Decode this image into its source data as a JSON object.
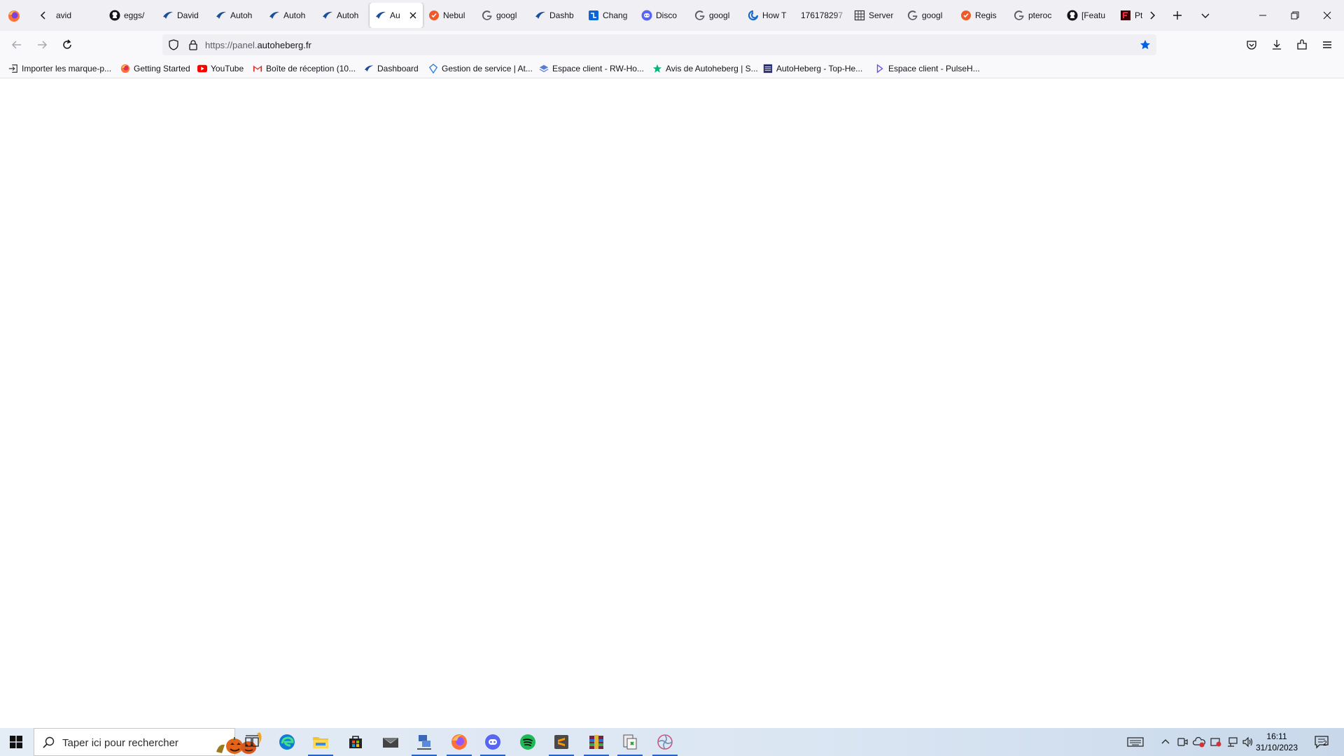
{
  "browser": {
    "tabs": [
      {
        "title": "avid",
        "icon": "partial-icon"
      },
      {
        "title": "eggs/",
        "icon": "github-icon"
      },
      {
        "title": "David",
        "icon": "autoheberg-icon"
      },
      {
        "title": "Autoh",
        "icon": "autoheberg-icon"
      },
      {
        "title": "Autoh",
        "icon": "autoheberg-icon"
      },
      {
        "title": "Autoh",
        "icon": "autoheberg-icon"
      },
      {
        "title": "Au",
        "icon": "autoheberg-icon",
        "active": true
      },
      {
        "title": "Nebul",
        "icon": "orange-check-icon"
      },
      {
        "title": "googl",
        "icon": "google-icon"
      },
      {
        "title": "Dashb",
        "icon": "autoheberg-icon"
      },
      {
        "title": "Chang",
        "icon": "blue-square-icon"
      },
      {
        "title": "Disco",
        "icon": "discord-icon"
      },
      {
        "title": "googl",
        "icon": "google-icon"
      },
      {
        "title": "How T",
        "icon": "blue-swirl-icon"
      },
      {
        "title": "176178297",
        "icon": "none"
      },
      {
        "title": "Server",
        "icon": "grid-icon"
      },
      {
        "title": "googl",
        "icon": "google-icon"
      },
      {
        "title": "Regis",
        "icon": "orange-check-icon"
      },
      {
        "title": "pteroc",
        "icon": "google-icon"
      },
      {
        "title": "[Featu",
        "icon": "github-icon"
      },
      {
        "title": "Pteroc",
        "icon": "pterodactyl-icon"
      }
    ],
    "url": {
      "prefix": "https://panel.",
      "domain": "autoheberg.fr"
    },
    "bookmarks": [
      {
        "label": "Importer les marque-p...",
        "icon": "import-icon"
      },
      {
        "label": "Getting Started",
        "icon": "firefox-icon"
      },
      {
        "label": "YouTube",
        "icon": "youtube-icon"
      },
      {
        "label": "Boîte de réception (10...",
        "icon": "gmail-icon"
      },
      {
        "label": "Dashboard",
        "icon": "autoheberg-icon"
      },
      {
        "label": "Gestion de service | At...",
        "icon": "diamond-icon"
      },
      {
        "label": "Espace client - RW-Ho...",
        "icon": "layers-icon"
      },
      {
        "label": "Avis de Autoheberg | S...",
        "icon": "star-icon"
      },
      {
        "label": "AutoHeberg - Top-He...",
        "icon": "server-icon"
      },
      {
        "label": "Espace client - PulseH...",
        "icon": "pulse-icon"
      }
    ]
  },
  "taskbar": {
    "search_placeholder": "Taper ici pour rechercher",
    "apps": [
      {
        "name": "task-view",
        "running": false
      },
      {
        "name": "edge",
        "running": false
      },
      {
        "name": "file-explorer",
        "running": true
      },
      {
        "name": "store",
        "running": false
      },
      {
        "name": "mail",
        "running": false
      },
      {
        "name": "network-app",
        "running": true
      },
      {
        "name": "firefox",
        "running": true
      },
      {
        "name": "discord",
        "running": true
      },
      {
        "name": "spotify",
        "running": false
      },
      {
        "name": "sublime",
        "running": true
      },
      {
        "name": "winrar",
        "running": true
      },
      {
        "name": "docs-app",
        "running": true
      },
      {
        "name": "pinwheel-app",
        "running": true
      }
    ],
    "time": "16:11",
    "date": "31/10/2023",
    "notification_count": "2"
  },
  "colors": {
    "accent": "#0060df",
    "taskbar_indicator": "#2563c9"
  }
}
